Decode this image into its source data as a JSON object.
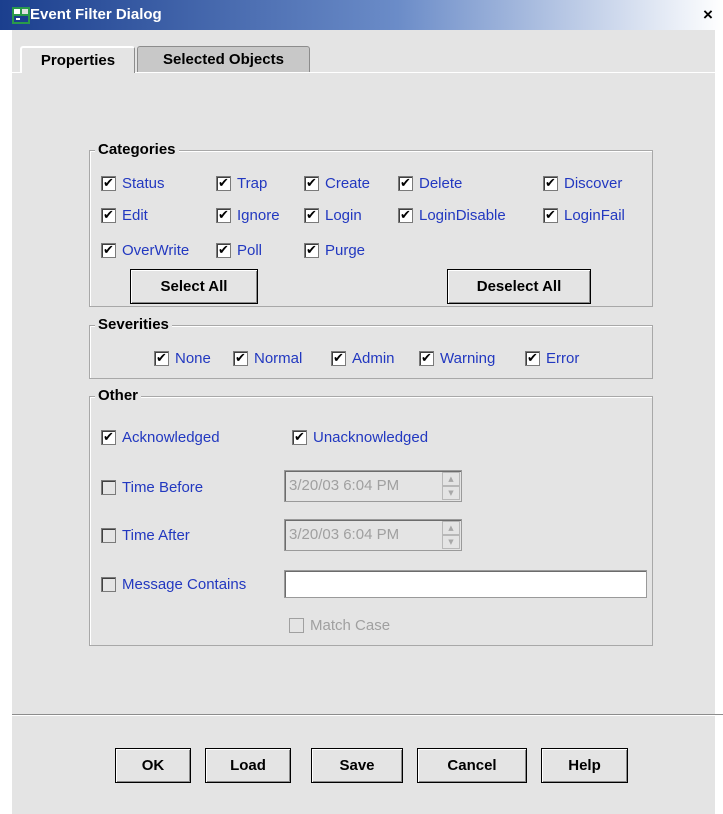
{
  "window": {
    "title": "Event Filter Dialog",
    "close_label": "×"
  },
  "tabs": [
    {
      "label": "Properties",
      "active": true
    },
    {
      "label": "Selected Objects",
      "active": false
    }
  ],
  "categories": {
    "legend": "Categories",
    "items": [
      {
        "label": "Status",
        "checked": true
      },
      {
        "label": "Trap",
        "checked": true
      },
      {
        "label": "Create",
        "checked": true
      },
      {
        "label": "Delete",
        "checked": true
      },
      {
        "label": "Discover",
        "checked": true
      },
      {
        "label": "Edit",
        "checked": true
      },
      {
        "label": "Ignore",
        "checked": true
      },
      {
        "label": "Login",
        "checked": true
      },
      {
        "label": "LoginDisable",
        "checked": true
      },
      {
        "label": "LoginFail",
        "checked": true
      },
      {
        "label": "OverWrite",
        "checked": true
      },
      {
        "label": "Poll",
        "checked": true
      },
      {
        "label": "Purge",
        "checked": true
      }
    ],
    "select_all_label": "Select All",
    "deselect_all_label": "Deselect All"
  },
  "severities": {
    "legend": "Severities",
    "items": [
      {
        "label": "None",
        "checked": true
      },
      {
        "label": "Normal",
        "checked": true
      },
      {
        "label": "Admin",
        "checked": true
      },
      {
        "label": "Warning",
        "checked": true
      },
      {
        "label": "Error",
        "checked": true
      }
    ]
  },
  "other": {
    "legend": "Other",
    "acknowledged": {
      "label": "Acknowledged",
      "checked": true
    },
    "unacknowledged": {
      "label": "Unacknowledged",
      "checked": true
    },
    "time_before": {
      "label": "Time Before",
      "checked": false,
      "value": "3/20/03 6:04 PM"
    },
    "time_after": {
      "label": "Time After",
      "checked": false,
      "value": "3/20/03 6:04 PM"
    },
    "message_contains": {
      "label": "Message Contains",
      "checked": false,
      "value": ""
    },
    "match_case": {
      "label": "Match Case",
      "checked": false,
      "enabled": false
    }
  },
  "buttons": {
    "ok": "OK",
    "load": "Load",
    "save": "Save",
    "cancel": "Cancel",
    "help": "Help"
  },
  "check_glyph": "✔",
  "colors": {
    "label_blue": "#2238c0",
    "panel_gray": "#e4e4e4",
    "title_blue": "#1b3f8e"
  }
}
